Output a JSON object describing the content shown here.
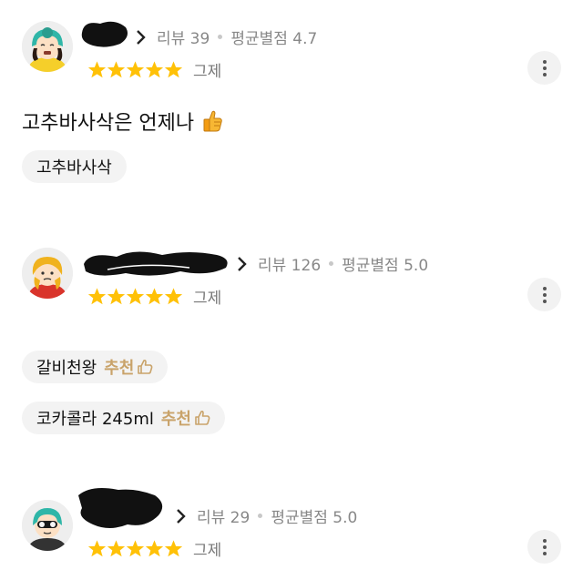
{
  "reviews": [
    {
      "review_count": "리뷰 39",
      "avg_rating": "평균별점 4.7",
      "rating": 5,
      "date": "그제",
      "text": "고추바사삭은 언제나",
      "menu_items": [
        {
          "name": "고추바사삭",
          "recommended": false
        }
      ]
    },
    {
      "review_count": "리뷰 126",
      "avg_rating": "평균별점 5.0",
      "rating": 5,
      "date": "그제",
      "text": "",
      "menu_items": [
        {
          "name": "갈비천왕",
          "recommended": true
        },
        {
          "name": "코카콜라 245ml",
          "recommended": true
        }
      ]
    },
    {
      "review_count": "리뷰 29",
      "avg_rating": "평균별점 5.0",
      "rating": 5,
      "date": "그제",
      "text": "",
      "menu_items": []
    }
  ],
  "recommend_label": "추천",
  "colors": {
    "star": "#ffc107",
    "recommend": "#c9a36a",
    "chip_bg": "#f3f3f3"
  }
}
